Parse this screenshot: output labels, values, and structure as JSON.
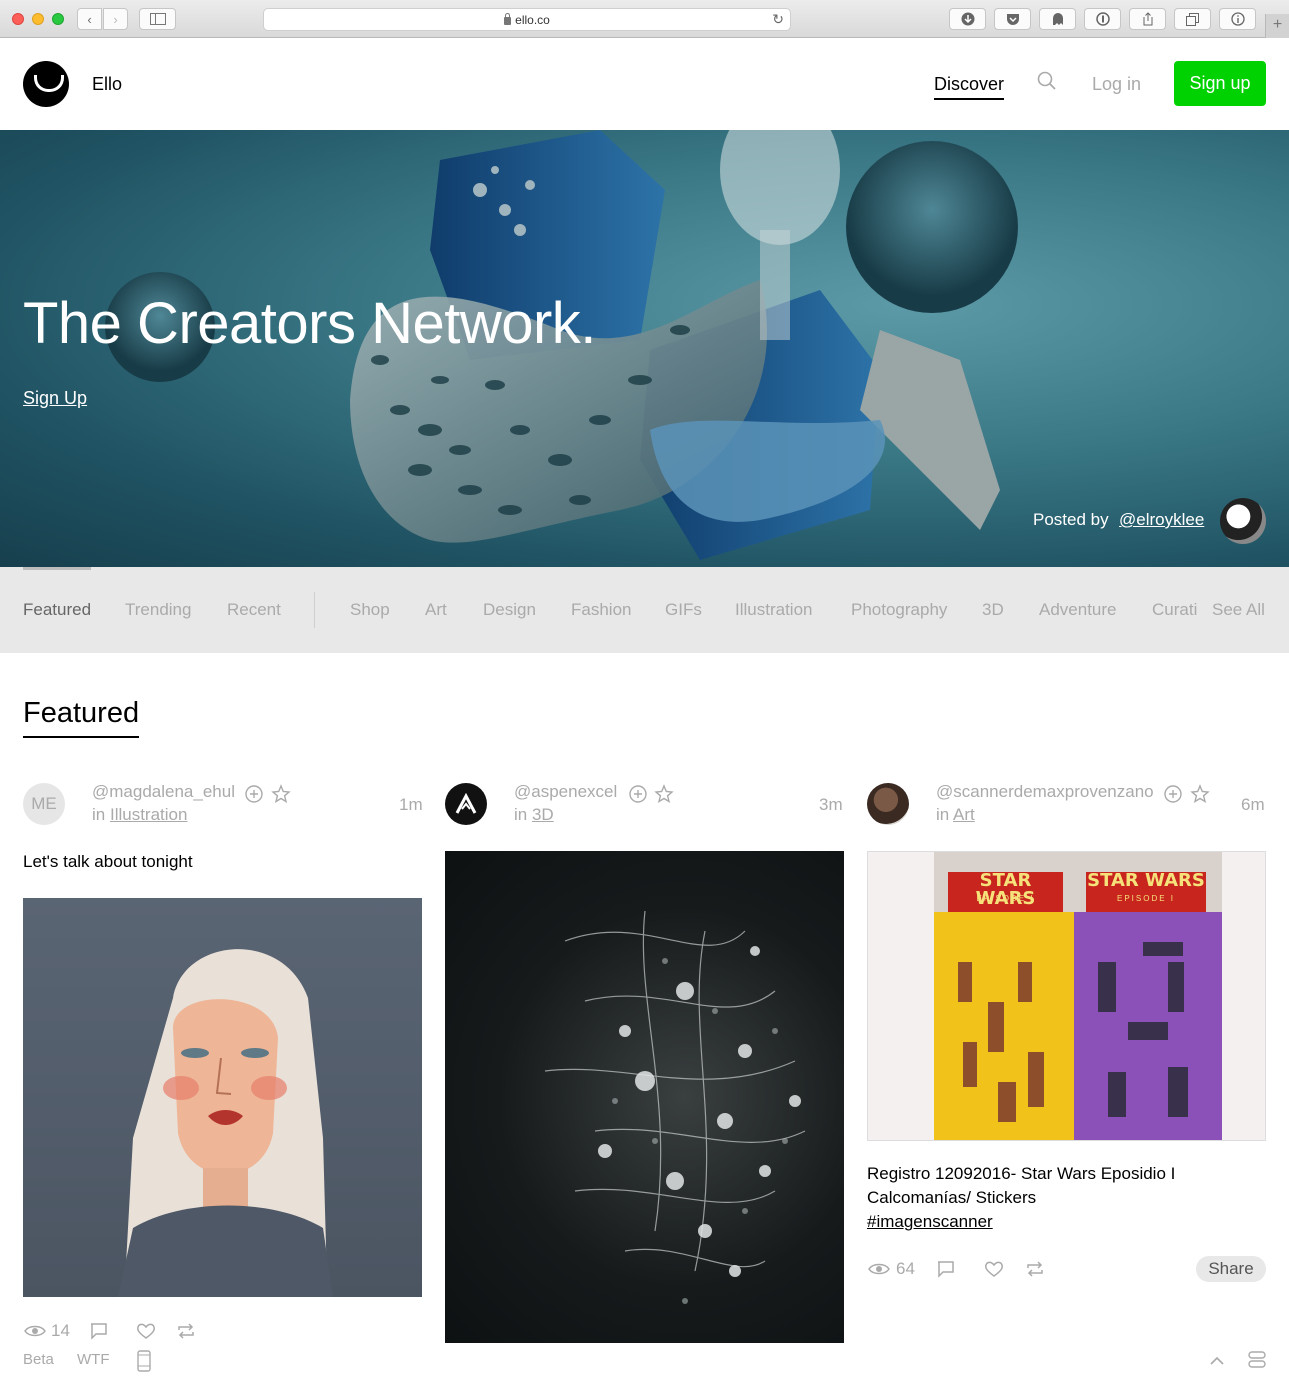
{
  "browser": {
    "url": "ello.co"
  },
  "header": {
    "brand": "Ello",
    "discover": "Discover",
    "login": "Log in",
    "signup": "Sign up"
  },
  "hero": {
    "title": "The Creators Network.",
    "signup_link": "Sign Up",
    "posted_by": "Posted by",
    "handle": "@elroyklee"
  },
  "categories": {
    "items": [
      "Featured",
      "Trending",
      "Recent",
      "Shop",
      "Art",
      "Design",
      "Fashion",
      "GIFs",
      "Illustration",
      "Photography",
      "3D",
      "Adventure",
      "Curati",
      "See All"
    ],
    "active": "Featured"
  },
  "featured": {
    "heading": "Featured"
  },
  "posts": [
    {
      "avatar_initials": "ME",
      "user": "@magdalena_ehul",
      "in_label": "in",
      "category": "Illustration",
      "time": "1m",
      "text": "Let's talk about tonight",
      "views": "14"
    },
    {
      "user": "@aspenexcel",
      "in_label": "in",
      "category": "3D",
      "time": "3m"
    },
    {
      "user": "@scannerdemaxprovenzano",
      "in_label": "in",
      "category": "Art",
      "time": "6m",
      "text_line1": "Registro 12092016- Star Wars Eposidio I",
      "text_line2": "Calcomanías/ Stickers",
      "hashtag": "#imagenscanner",
      "views": "64",
      "share": "Share",
      "sticker_title": "STAR WARS",
      "sticker_subtitle": "EPISODE I"
    }
  ],
  "footer": {
    "beta": "Beta",
    "wtf": "WTF"
  },
  "colors": {
    "brand_green": "#00d100",
    "muted_text": "#aaaaaa",
    "category_bar": "#e8e8e8"
  },
  "icons": [
    "back-icon",
    "forward-icon",
    "sidebar-icon",
    "reload-icon",
    "download-icon",
    "pocket-icon",
    "ghost-icon",
    "onepassword-icon",
    "share-icon",
    "tabs-icon",
    "info-icon",
    "search-icon",
    "follow-plus-icon",
    "star-icon",
    "eye-icon",
    "comment-icon",
    "heart-icon",
    "repost-icon",
    "mobile-icon",
    "chevron-up-icon",
    "grid-toggle-icon"
  ]
}
